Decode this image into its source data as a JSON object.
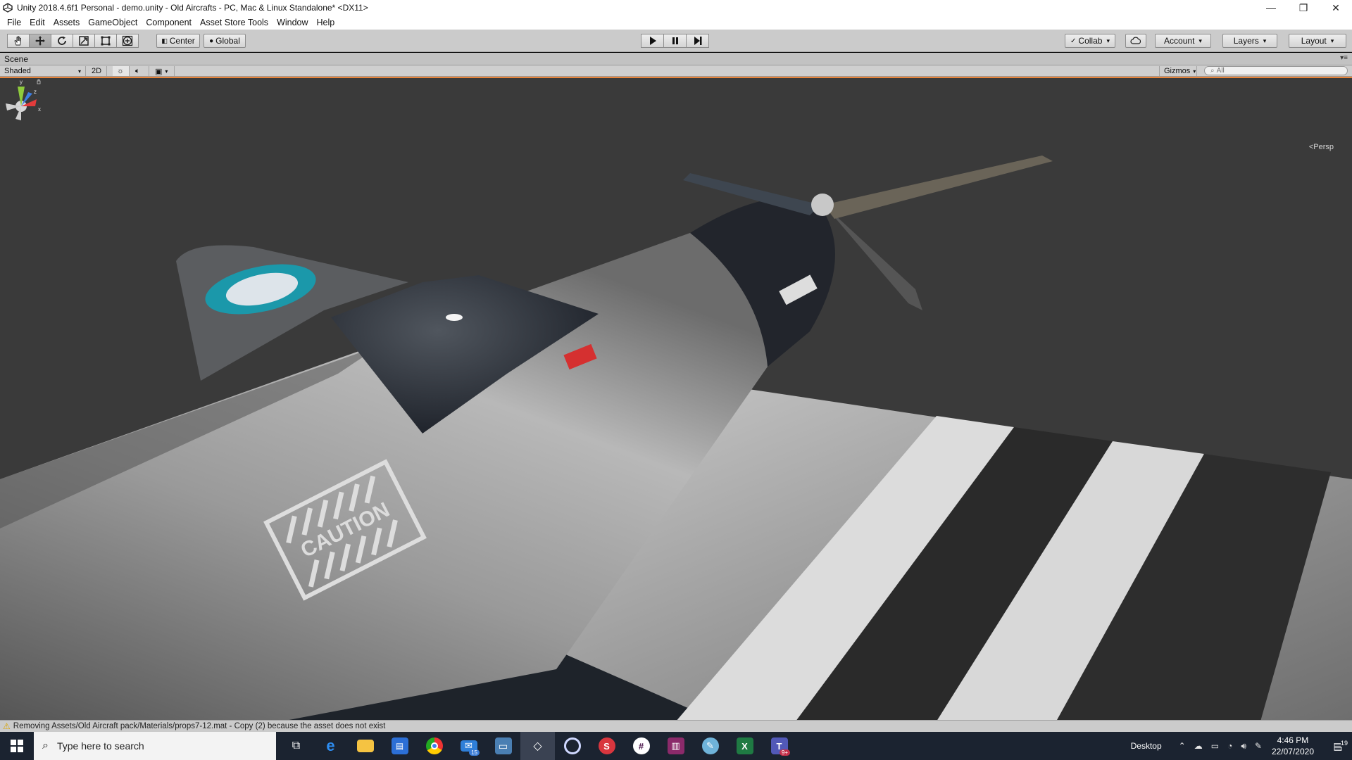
{
  "window": {
    "title": "Unity 2018.4.6f1 Personal - demo.unity - Old Aircrafts - PC, Mac & Linux Standalone* <DX11>",
    "controls": [
      "—",
      "❐",
      "✕"
    ]
  },
  "menu": [
    "File",
    "Edit",
    "Assets",
    "GameObject",
    "Component",
    "Asset Store Tools",
    "Window",
    "Help"
  ],
  "toolbar": {
    "tools": [
      "hand-icon",
      "move-icon",
      "rotate-icon",
      "scale-icon",
      "rect-icon",
      "transform-icon"
    ],
    "pivot_label": "Center",
    "space_label": "Global",
    "collab_label": "Collab",
    "account_label": "Account",
    "layers_label": "Layers",
    "layout_label": "Layout"
  },
  "scene": {
    "tab_label": "Scene",
    "shading_mode": "Shaded",
    "toggle_2d": "2D",
    "gizmos_label": "Gizmos",
    "search_placeholder": "All",
    "projection_label": "Persp",
    "axes": [
      "y",
      "z",
      "x"
    ],
    "decal_text": "CAUTION"
  },
  "status": {
    "message": "Removing Assets/Old Aircraft pack/Materials/props7-12.mat - Copy (2) because the asset does not exist"
  },
  "taskbar": {
    "search_placeholder": "Type here to search",
    "mail_badge": "15",
    "teams_badge": "9+",
    "desktop_label": "Desktop",
    "time": "4:46 PM",
    "date": "22/07/2020",
    "notifications": "19"
  }
}
